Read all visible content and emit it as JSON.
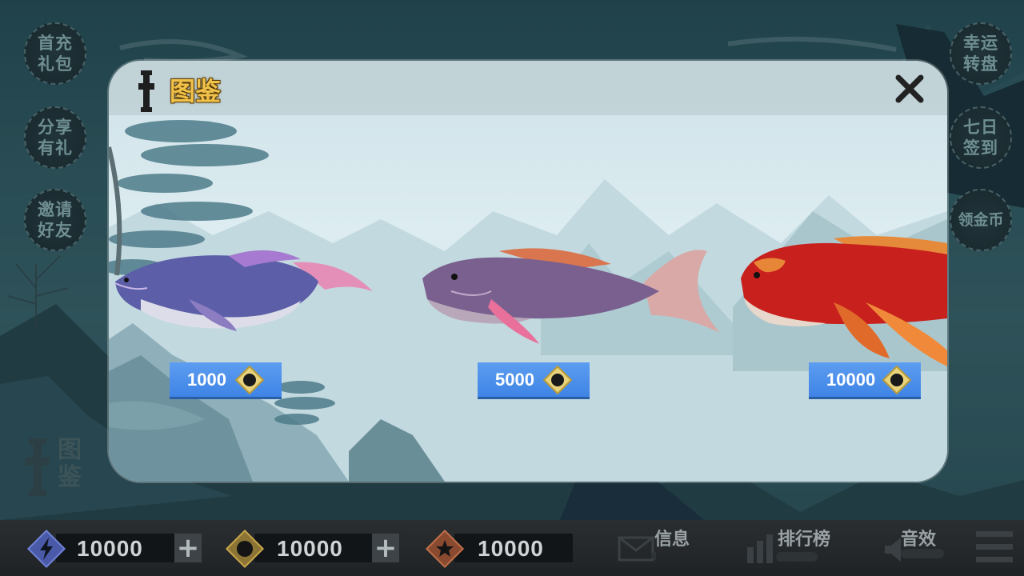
{
  "side_menu": {
    "left": [
      {
        "label": "首充\n礼包"
      },
      {
        "label": "分享\n有礼"
      },
      {
        "label": "邀请\n好友"
      }
    ],
    "right": [
      {
        "label": "幸运\n转盘"
      },
      {
        "label": "七日\n签到"
      },
      {
        "label": "领金币"
      }
    ]
  },
  "tujian_button": {
    "label": "图\n鉴"
  },
  "currencies": {
    "energy": {
      "value": "10000",
      "icon": "lightning-icon",
      "color": "#5b6fc7"
    },
    "coins": {
      "value": "10000",
      "icon": "coin-icon",
      "color": "#c9a64a"
    },
    "stars": {
      "value": "10000",
      "icon": "star-icon",
      "color": "#c0704a"
    }
  },
  "bottom_nav": {
    "messages": {
      "label": "信息",
      "icon": "mail-icon"
    },
    "leaderboard": {
      "label": "排行榜",
      "icon": "bar-chart-icon"
    },
    "sound": {
      "label": "音效",
      "icon": "speaker-icon"
    },
    "menu_icon": "hamburger-menu-icon"
  },
  "modal": {
    "title": "图鉴",
    "close_icon": "close-icon",
    "fish": [
      {
        "name": "blue-koi",
        "price": "1000",
        "price_icon": "coin-icon"
      },
      {
        "name": "purple-carp",
        "price": "5000",
        "price_icon": "coin-icon"
      },
      {
        "name": "red-whale",
        "price": "10000",
        "price_icon": "coin-icon"
      }
    ]
  },
  "colors": {
    "accent_blue": "#4a8ee8",
    "title_gold": "#f0c24a"
  }
}
